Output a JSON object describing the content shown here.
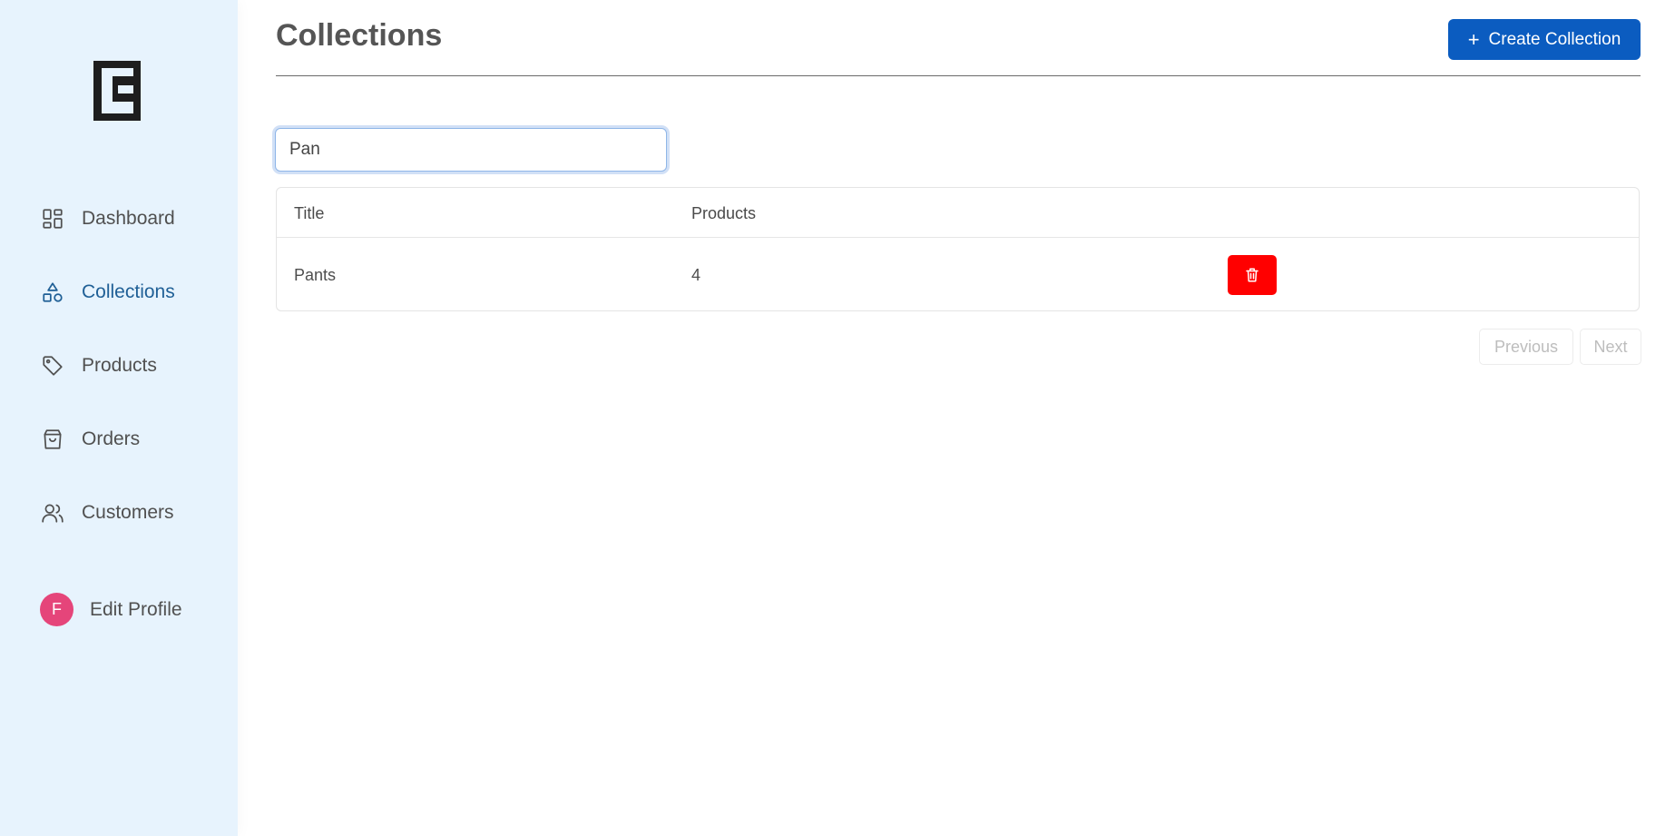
{
  "sidebar": {
    "logo_icon": "brand-logo-icon",
    "items": [
      {
        "label": "Dashboard",
        "icon": "dashboard-grid-icon",
        "active": false
      },
      {
        "label": "Collections",
        "icon": "shapes-icon",
        "active": true
      },
      {
        "label": "Products",
        "icon": "tag-icon",
        "active": false
      },
      {
        "label": "Orders",
        "icon": "shopping-bag-icon",
        "active": false
      },
      {
        "label": "Customers",
        "icon": "users-icon",
        "active": false
      }
    ],
    "profile": {
      "avatar_initial": "F",
      "label": "Edit Profile"
    }
  },
  "header": {
    "title": "Collections",
    "create_button_label": "Create Collection",
    "create_button_icon": "plus-icon"
  },
  "search": {
    "value": "Pan",
    "placeholder": ""
  },
  "table": {
    "columns": [
      "Title",
      "Products"
    ],
    "rows": [
      {
        "title": "Pants",
        "products": "4",
        "action_icon": "trash-icon"
      }
    ]
  },
  "pagination": {
    "previous_label": "Previous",
    "next_label": "Next"
  },
  "colors": {
    "sidebar_bg": "#e7f3fd",
    "active_nav": "#1f5f96",
    "primary_button": "#0b5cc0",
    "danger_button": "#ff0000",
    "avatar_bg": "#e5457a"
  }
}
